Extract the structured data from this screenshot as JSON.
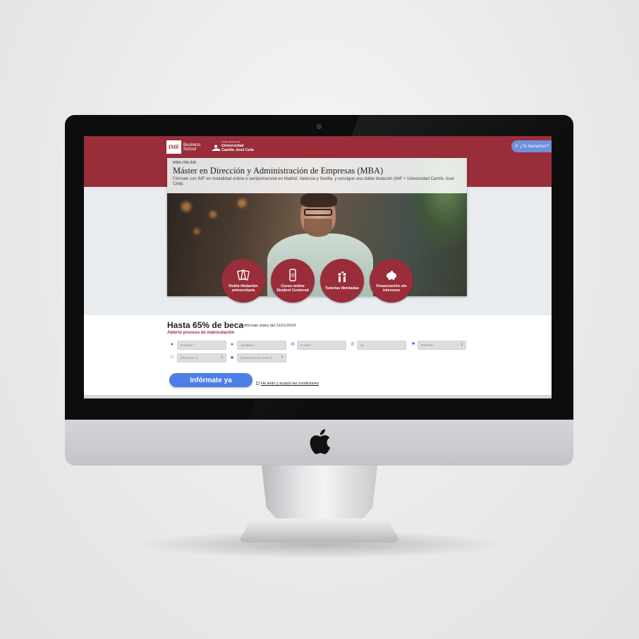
{
  "header": {
    "logo_imf": "IMF",
    "logo_business": "Business",
    "logo_school": "School",
    "partner_small": "Centro adscrito a la",
    "partner_name_1": "Universidad",
    "partner_name_2": "Camilo José Cela",
    "call_button": "¿Te llamamos?"
  },
  "hero": {
    "kicker": "MBA ONLINE",
    "title": "Máster en Dirección y Administración de Empresas (MBA)",
    "description": "Fórmate con IMF en modalidad online o semipresencial en Madrid, Valencia y Sevilla, y consigue una doble titulación (IMF + Universidad Camilo José Cela)."
  },
  "features": [
    {
      "label": "Doble titulación universitaria",
      "icon": "certificate-icon"
    },
    {
      "label": "Curso online Student Centered",
      "icon": "mobile-icon"
    },
    {
      "label": "Tutorías ilimitadas",
      "icon": "people-icon"
    },
    {
      "label": "Financiación sin intereses",
      "icon": "piggy-bank-icon"
    }
  ],
  "form": {
    "title": "Hasta 65% de beca",
    "deadline": "Infórmate antes del 31/01/2018",
    "subtitle": "Abierto proceso de matriculación",
    "nombre": "Nombre *",
    "apellidos": "Apellidos *",
    "email": "E-mail *",
    "phone": "34",
    "country": "ESPAÑA",
    "province": "[Provincia *]",
    "course": "[Selecciona tu curso *]",
    "submit": "Infórmate ya",
    "conditions": "He leído y acepto las condiciones"
  },
  "colors": {
    "brand": "#9a2d3a",
    "accent": "#4d7fe6"
  }
}
